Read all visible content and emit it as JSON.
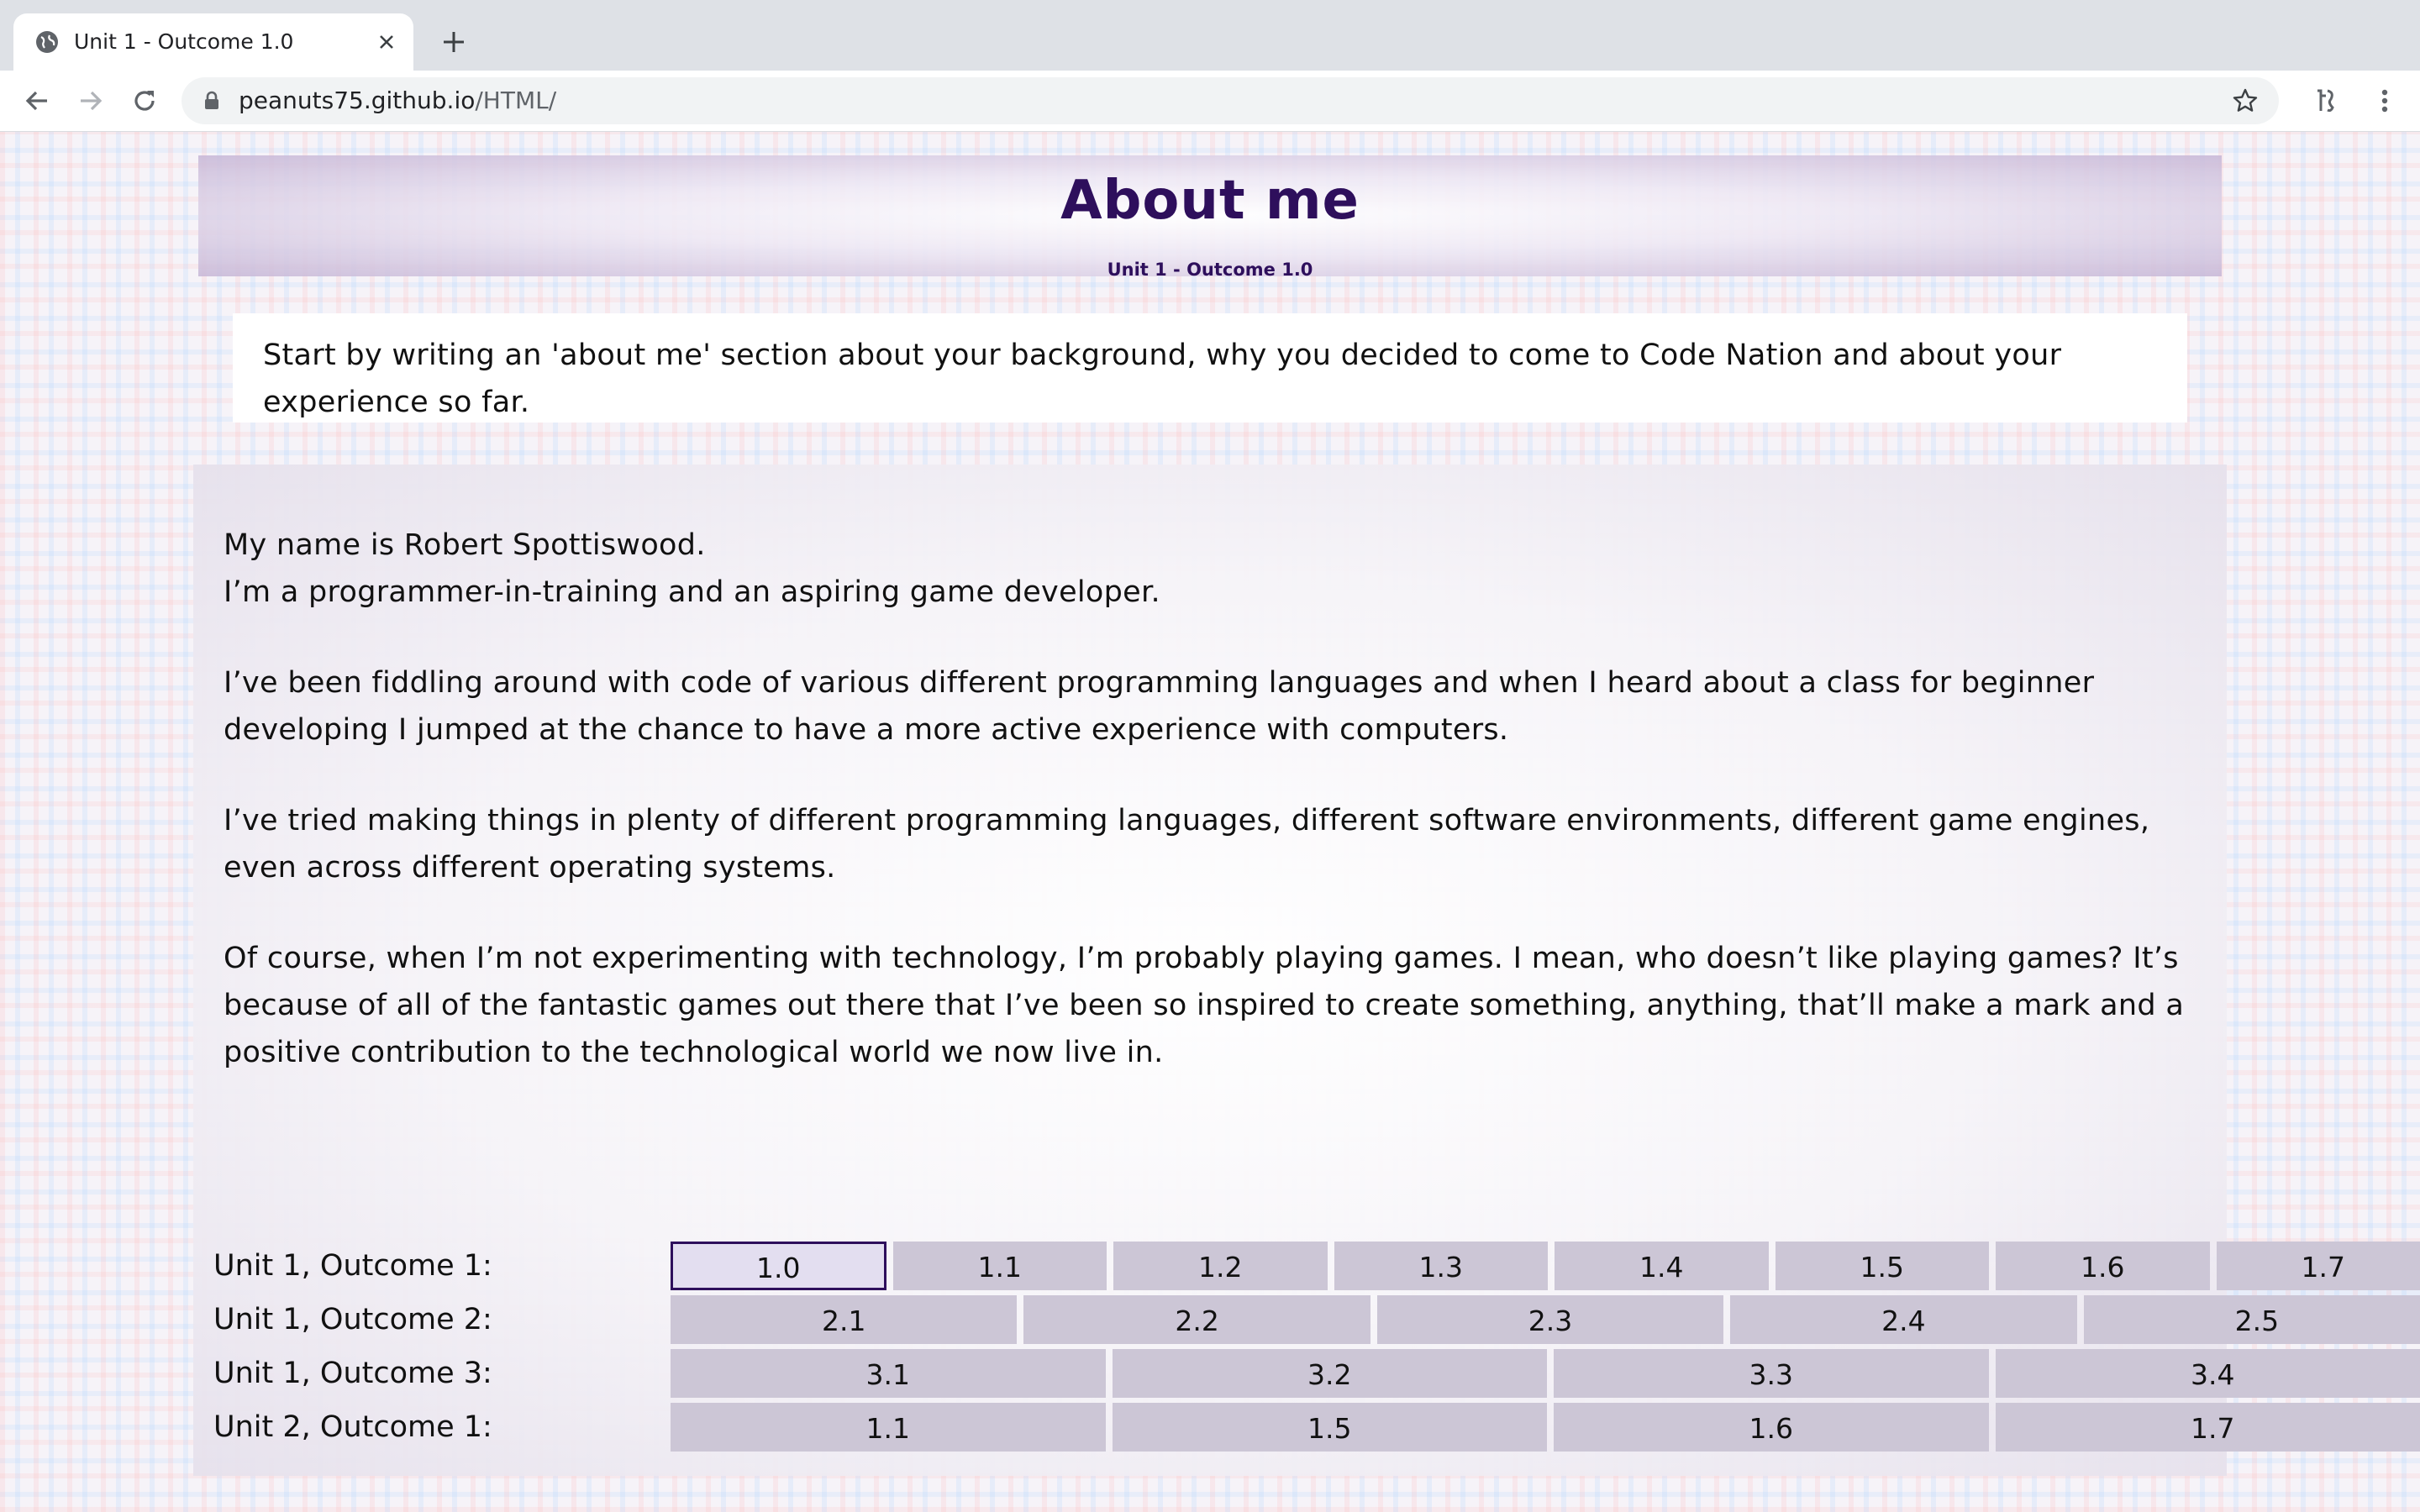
{
  "browser": {
    "tab_title": "Unit 1 - Outcome 1.0",
    "url_host": "peanuts75.github.io",
    "url_path": "/HTML/"
  },
  "page": {
    "title": "About me",
    "subtitle": "Unit 1 - Outcome 1.0",
    "prompt": "Start by writing an 'about me' section about your background, why you decided to come to Code Nation and about your experience so far.",
    "paragraphs": [
      "My name is Robert Spottiswood.\nI’m a programmer-in-training and an aspiring game developer.",
      "I’ve been fiddling around with code of various different programming languages and when I heard about a class for beginner developing I jumped at the chance to have a more active experience with computers.",
      "I’ve tried making things in plenty of different programming languages, different software environments, different game engines, even across different operating systems.",
      "Of course, when I’m not experimenting with technology, I’m probably playing games. I mean, who doesn’t like playing games? It’s because of all of the fantastic games out there that I’ve been so inspired to create something, anything, that’ll make a mark and a positive contribution to the technological world we now live in."
    ]
  },
  "outcomes": [
    {
      "label": "Unit 1, Outcome 1:",
      "items": [
        "1.0",
        "1.1",
        "1.2",
        "1.3",
        "1.4",
        "1.5",
        "1.6",
        "1.7"
      ],
      "active": "1.0"
    },
    {
      "label": "Unit 1, Outcome 2:",
      "items": [
        "2.1",
        "2.2",
        "2.3",
        "2.4",
        "2.5"
      ]
    },
    {
      "label": "Unit 1, Outcome 3:",
      "items": [
        "3.1",
        "3.2",
        "3.3",
        "3.4"
      ]
    },
    {
      "label": "Unit 2, Outcome 1:",
      "items": [
        "1.1",
        "1.5",
        "1.6",
        "1.7"
      ]
    }
  ],
  "colors": {
    "title": "#2e0f5c",
    "button_bg": "#ccc6d6",
    "active_border": "#2e0f5c"
  }
}
